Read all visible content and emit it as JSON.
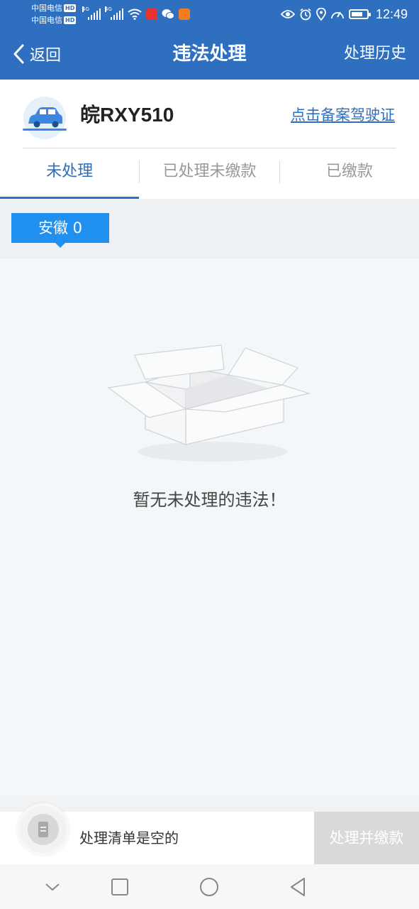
{
  "status_bar": {
    "carrier_1": "中国电信",
    "carrier_2": "中国电信",
    "hd_badge": "HD",
    "network_1": "4G",
    "network_2": "4G",
    "time": "12:49",
    "battery_level": 0.75
  },
  "nav": {
    "back_label": "返回",
    "title": "违法处理",
    "history_label": "处理历史"
  },
  "vehicle": {
    "plate": "皖RXY510",
    "record_link": "点击备案驾驶证"
  },
  "tabs": [
    {
      "label": "未处理",
      "active": true
    },
    {
      "label": "已处理未缴款",
      "active": false
    },
    {
      "label": "已缴款",
      "active": false
    }
  ],
  "region_filter": {
    "label": "安徽 0"
  },
  "empty_state": {
    "message": "暂无未处理的违法！"
  },
  "cart_bar": {
    "text": "处理清单是空的",
    "button_label": "处理并缴款"
  },
  "colors": {
    "primary": "#2e6fc0",
    "chip": "#1f8ff0",
    "disabled_button": "#d9d9d9",
    "background": "#f4f7f9"
  },
  "icons": {
    "back": "chevron-left-icon",
    "car": "car-icon",
    "empty": "empty-box-icon",
    "cart": "list-icon"
  }
}
